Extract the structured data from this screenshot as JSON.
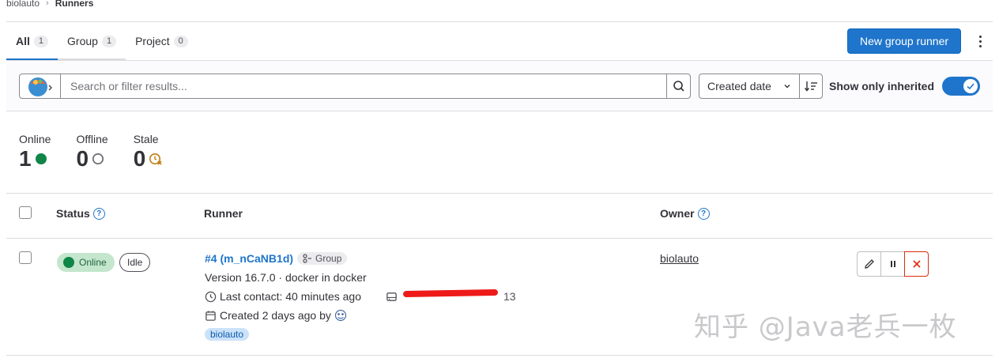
{
  "breadcrumb": {
    "parent": "biolauto",
    "separator": "›",
    "current": "Runners"
  },
  "tabs": [
    {
      "label": "All",
      "count": "1"
    },
    {
      "label": "Group",
      "count": "1"
    },
    {
      "label": "Project",
      "count": "0"
    }
  ],
  "header": {
    "new_runner_label": "New group runner"
  },
  "filter": {
    "search_placeholder": "Search or filter results...",
    "sort_label": "Created date",
    "show_inherited_label": "Show only inherited",
    "show_inherited": true
  },
  "stats": [
    {
      "label": "Online",
      "value": "1"
    },
    {
      "label": "Offline",
      "value": "0"
    },
    {
      "label": "Stale",
      "value": "0"
    }
  ],
  "table": {
    "headers": {
      "status": "Status",
      "runner": "Runner",
      "owner": "Owner"
    }
  },
  "runner": {
    "status": "Online",
    "state": "Idle",
    "name": "#4 (m_nCaNB1d)",
    "type": "Group",
    "version": "Version 16.7.0 · docker in docker",
    "last_contact": "Last contact: 40 minutes ago",
    "ip_partial": "13",
    "created": "Created 2 days ago by",
    "tag": "biolauto",
    "owner": "biolauto"
  },
  "watermark": "知乎 @Java老兵一枚",
  "colors": {
    "primary": "#1f75cb",
    "online": "#108548",
    "danger": "#dd2b0e"
  }
}
